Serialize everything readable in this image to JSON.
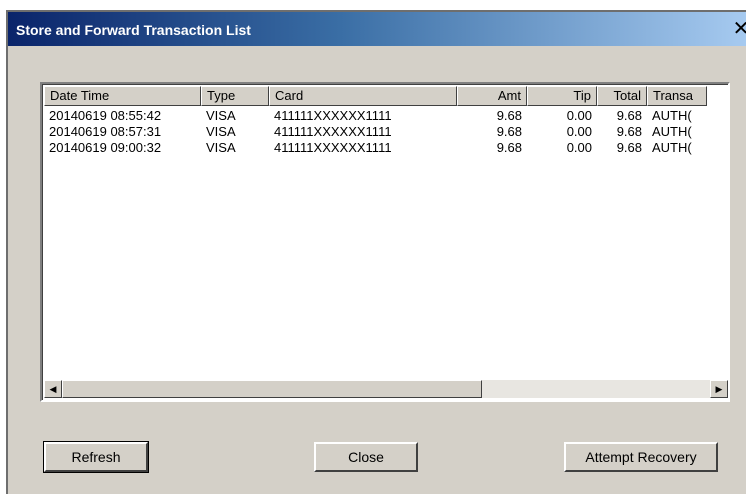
{
  "window": {
    "title": "Store and Forward Transaction List",
    "close_glyph": "✕"
  },
  "list": {
    "columns": [
      {
        "label": "Date Time"
      },
      {
        "label": "Type"
      },
      {
        "label": "Card"
      },
      {
        "label": "Amt"
      },
      {
        "label": "Tip"
      },
      {
        "label": "Total"
      },
      {
        "label": "Transa"
      }
    ],
    "rows": [
      {
        "datetime": "20140619 08:55:42",
        "type": "VISA",
        "card": "411111XXXXXX1111",
        "amt": "9.68",
        "tip": "0.00",
        "total": "9.68",
        "trans": "AUTH("
      },
      {
        "datetime": "20140619 08:57:31",
        "type": "VISA",
        "card": "411111XXXXXX1111",
        "amt": "9.68",
        "tip": "0.00",
        "total": "9.68",
        "trans": "AUTH("
      },
      {
        "datetime": "20140619 09:00:32",
        "type": "VISA",
        "card": "411111XXXXXX1111",
        "amt": "9.68",
        "tip": "0.00",
        "total": "9.68",
        "trans": "AUTH("
      }
    ]
  },
  "scrollbar": {
    "left_arrow": "◀",
    "right_arrow": "▶"
  },
  "buttons": {
    "refresh": "Refresh",
    "close": "Close",
    "attempt_recovery": "Attempt Recovery"
  }
}
